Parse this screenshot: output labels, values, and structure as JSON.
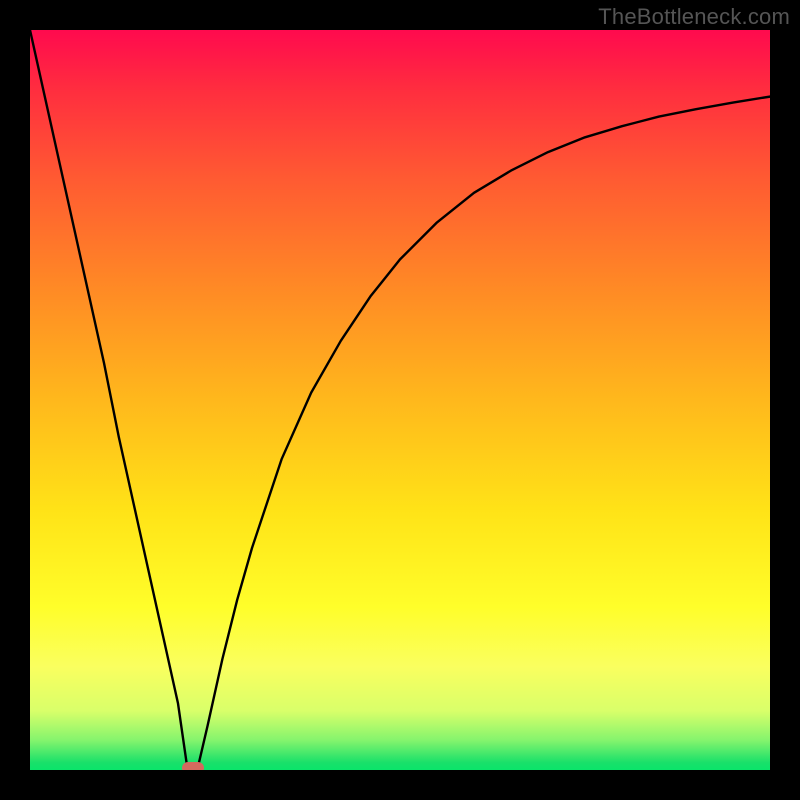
{
  "watermark": "TheBottleneck.com",
  "colors": {
    "frame": "#000000",
    "curve": "#000000",
    "marker": "#d46a5e"
  },
  "chart_data": {
    "type": "line",
    "title": "",
    "xlabel": "",
    "ylabel": "",
    "xlim": [
      0,
      100
    ],
    "ylim": [
      0,
      100
    ],
    "grid": false,
    "series": [
      {
        "name": "curve",
        "x": [
          0,
          2,
          4,
          6,
          8,
          10,
          12,
          14,
          16,
          18,
          20,
          21.3,
          22.6,
          24,
          26,
          28,
          30,
          34,
          38,
          42,
          46,
          50,
          55,
          60,
          65,
          70,
          75,
          80,
          85,
          90,
          95,
          100
        ],
        "y": [
          100,
          91,
          82,
          73,
          64,
          55,
          45,
          36,
          27,
          18,
          9,
          0,
          0,
          6,
          15,
          23,
          30,
          42,
          51,
          58,
          64,
          69,
          74,
          78,
          81,
          83.5,
          85.5,
          87,
          88.3,
          89.3,
          90.2,
          91
        ]
      }
    ],
    "annotations": [
      {
        "name": "marker",
        "x": 22,
        "y": 0,
        "width_pct": 3,
        "height_pct": 1.6
      }
    ],
    "background_gradient": {
      "direction": "top-to-bottom",
      "stops": [
        {
          "pos": 0,
          "color": "#ff0a4e"
        },
        {
          "pos": 50,
          "color": "#ffb81c"
        },
        {
          "pos": 80,
          "color": "#fffe2a"
        },
        {
          "pos": 100,
          "color": "#0ae46a"
        }
      ]
    }
  }
}
